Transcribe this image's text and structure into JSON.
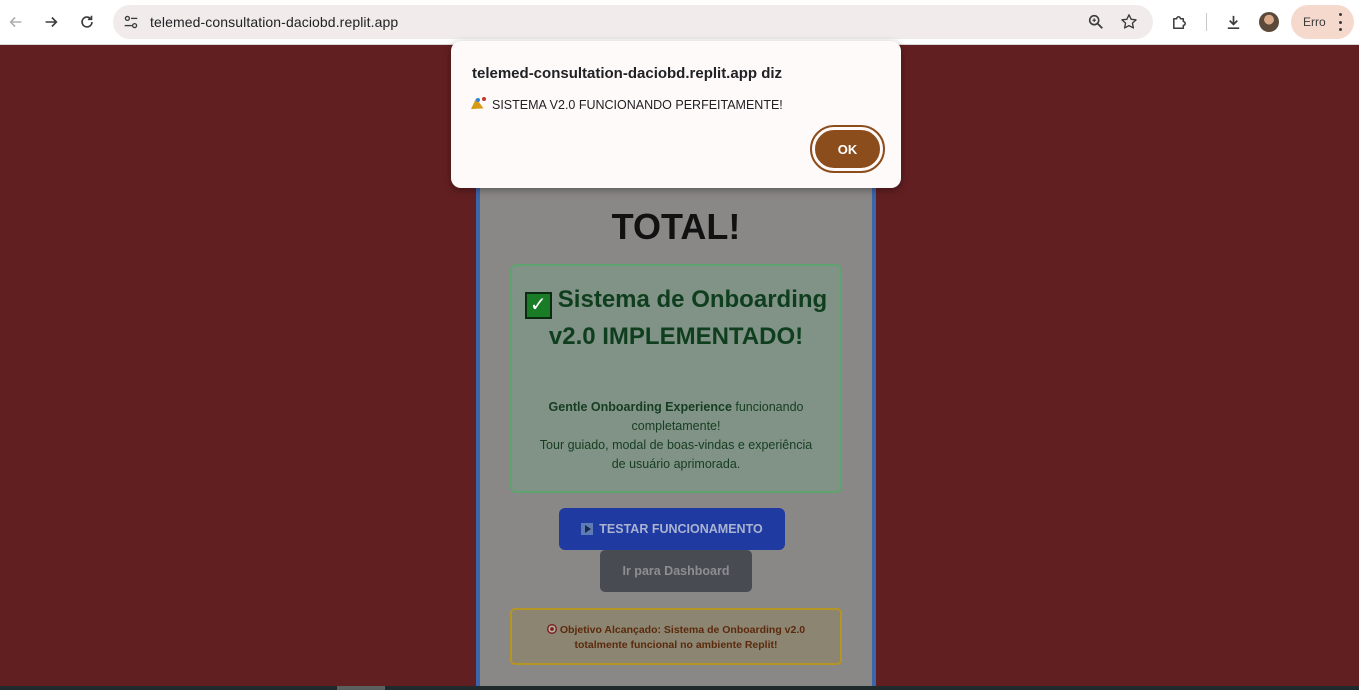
{
  "browser": {
    "url": "telemed-consultation-daciobd.replit.app",
    "profile_label": "Erro"
  },
  "page": {
    "hero_title": "TOTAL!",
    "success_box": {
      "title": "Sistema de Onboarding v2.0 IMPLEMENTADO!",
      "desc_bold": "Gentle Onboarding Experience",
      "desc_rest": " funcionando completamente!",
      "desc_line2": "Tour guiado, modal de boas-vindas e experiência de usuário aprimorada."
    },
    "test_button_label": "TESTAR FUNCIONAMENTO",
    "dashboard_button_label": "Ir para Dashboard",
    "goal_text": "Objetivo Alcançado: Sistema de Onboarding v2.0 totalmente funcional no ambiente Replit!"
  },
  "dialog": {
    "title": "telemed-consultation-daciobd.replit.app diz",
    "message": "SISTEMA V2.0 FUNCIONANDO PERFEITAMENTE!",
    "ok_label": "OK"
  },
  "colors": {
    "page_background": "#621f21",
    "ok_button": "#8c4d1d",
    "test_button": "#1f3aa0",
    "success_border": "#5fa36f",
    "goal_border": "#b59524"
  }
}
